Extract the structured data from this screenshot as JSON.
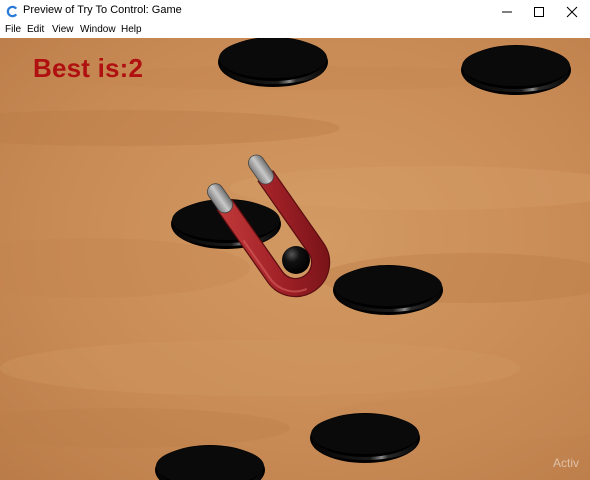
{
  "window": {
    "title": "Preview of Try To Control: Game"
  },
  "menu": {
    "items": [
      "File",
      "Edit",
      "View",
      "Window",
      "Help"
    ]
  },
  "game": {
    "score_text": "Best is:2",
    "watermark": "Activ"
  },
  "colors": {
    "score": "#b01010",
    "background": "#c98d58",
    "magnet": "#a3242a"
  }
}
